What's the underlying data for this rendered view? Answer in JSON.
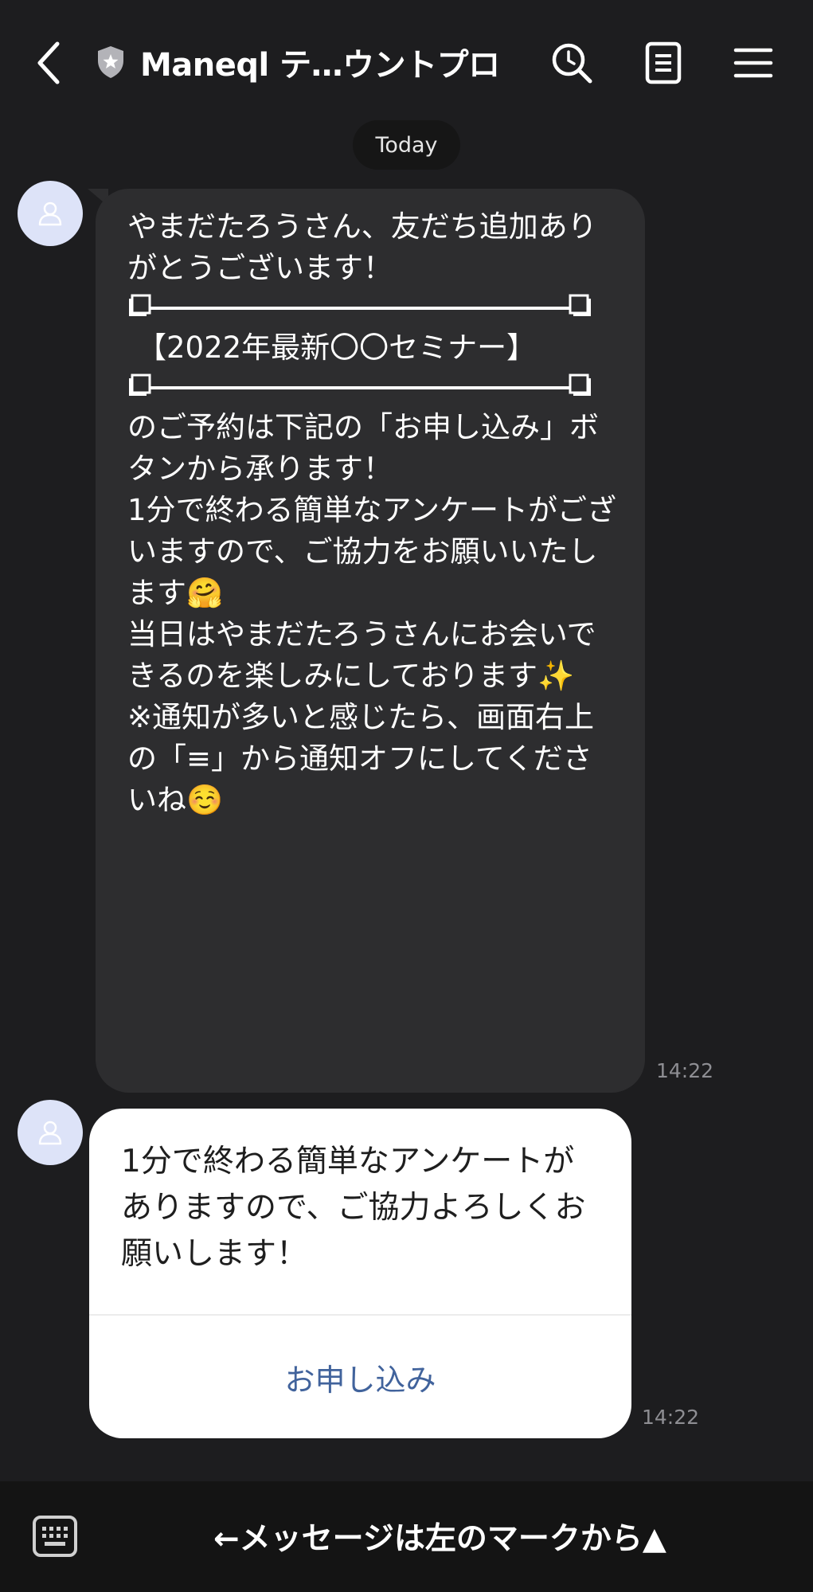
{
  "header": {
    "title": "Maneql テ…ウントプロ",
    "icons": [
      "back-arrow-icon",
      "shield-star-icon",
      "search-icon",
      "notes-icon",
      "menu-icon"
    ]
  },
  "date_separator": "Today",
  "messages": [
    {
      "type": "text",
      "lines": [
        "やまだたろうさん、友だち追加ありがとうございます！",
        "",
        "【2022年最新〇〇セミナー】",
        "",
        "のご予約は下記の「お申し込み」ボタンから承ります！",
        "",
        "1分で終わる簡単なアンケートがございますので、ご協力をお願いいたします🤗",
        "",
        "当日はやまだたろうさんにお会いできるのを楽しみにしております✨",
        "",
        "※通知が多いと感じたら、画面右上の「≡」から通知オフにしてくださいね☺️"
      ],
      "time": "14:22"
    },
    {
      "type": "card",
      "text": "1分で終わる簡単なアンケートがありますので、ご協力よろしくお願いします！",
      "button_label": "お申し込み",
      "time": "14:22"
    }
  ],
  "bottom_bar": {
    "hint": "←メッセージは左のマークから▲"
  },
  "colors": {
    "background": "#1d1d1f",
    "bubble": "#2d2d2f",
    "avatar": "#dde3f8",
    "card_button_text": "#41639c"
  }
}
